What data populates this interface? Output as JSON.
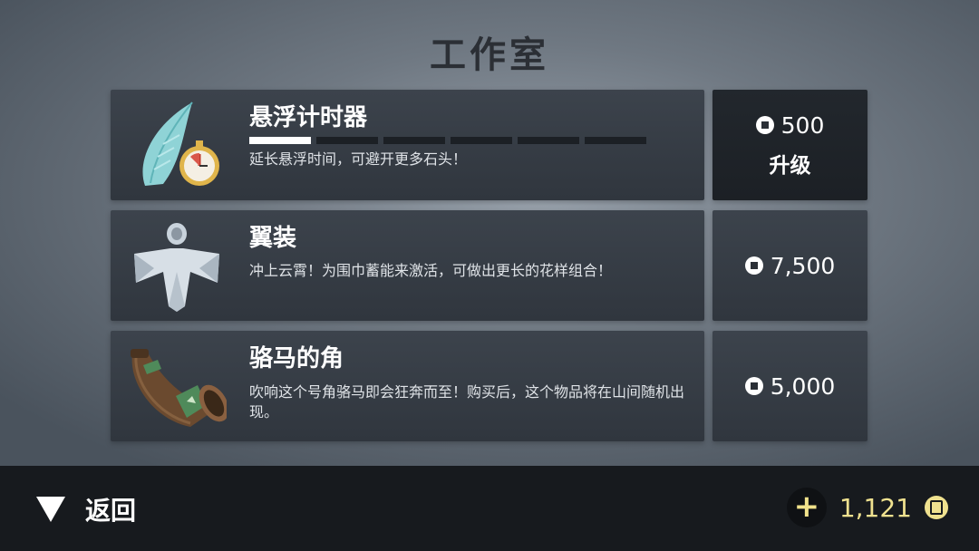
{
  "page": {
    "title": "工作室"
  },
  "items": [
    {
      "name": "悬浮计时器",
      "description": "延长悬浮时间，可避开更多石头！",
      "price": "500",
      "action_label": "升级",
      "icon": "feather-stopwatch-icon",
      "upgrade_progress": {
        "filled": 1,
        "total": 6
      }
    },
    {
      "name": "翼装",
      "description": "冲上云霄！为围巾蓄能来激活，可做出更长的花样组合！",
      "price": "7,500",
      "icon": "wingsuit-icon"
    },
    {
      "name": "骆马的角",
      "description": "吹响这个号角骆马即会狂奔而至！购买后，这个物品将在山间随机出现。",
      "price": "5,000",
      "icon": "horn-icon"
    }
  ],
  "footer": {
    "back_label": "返回",
    "back_icon": "triangle-down-icon",
    "balance": "1,121",
    "add_icon": "plus-icon",
    "coin_icon": "coin-icon"
  },
  "colors": {
    "currency_gold": "#efe18f",
    "panel": "#353b43",
    "panel_active": "#1f2328"
  }
}
